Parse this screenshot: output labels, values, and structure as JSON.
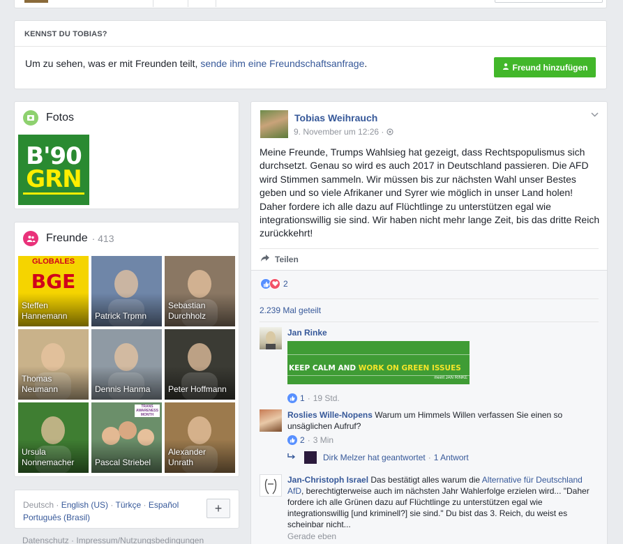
{
  "kennst": {
    "title": "KENNST DU TOBIAS?",
    "text_prefix": "Um zu sehen, was er mit Freunden teilt, ",
    "link": "sende ihm eine Freundschaftsanfrage",
    "text_suffix": ".",
    "button_label": "Freund hinzufügen"
  },
  "fotos": {
    "title": "Fotos",
    "photo_line1": "B'90",
    "photo_line2": "GRN"
  },
  "freunde": {
    "title": "Freunde",
    "count": "· 413",
    "items": [
      {
        "line1": "Steffen",
        "line2": "Hannemann",
        "bg": "#f5d400",
        "overlay_top": "GLOBALES",
        "overlay_main": "BGE"
      },
      {
        "line1": "Patrick Trpmn",
        "line2": "",
        "bg": "#6f86a8"
      },
      {
        "line1": "Sebastian",
        "line2": "Durchholz",
        "bg": "#8a7763"
      },
      {
        "line1": "Thomas",
        "line2": "Neumann",
        "bg": "#c9b28a"
      },
      {
        "line1": "Dennis Hanma",
        "line2": "",
        "bg": "#8f9aa4"
      },
      {
        "line1": "Peter Hoffmann",
        "line2": "",
        "bg": "#3b3b34"
      },
      {
        "line1": "Ursula",
        "line2": "Nonnemacher",
        "bg": "#3f7e32"
      },
      {
        "line1": "Pascal Striebel",
        "line2": "",
        "bg": "#6b8f6a",
        "overlay_top": "TRANS AWARENESS MONTH"
      },
      {
        "line1": "Alexander",
        "line2": "Unrath",
        "bg": "#9c7a4d"
      }
    ]
  },
  "languages": {
    "current": "Deutsch",
    "sep": " · ",
    "others": [
      "English (US)",
      "Türkçe",
      "Español",
      "Português (Brasil)"
    ],
    "plus": "+"
  },
  "footer": {
    "text": "Datenschutz · Impressum/Nutzungsbedingungen"
  },
  "post": {
    "author": "Tobias Weihrauch",
    "time": "9. November um 12:26 ·",
    "text": "Meine Freunde, Trumps Wahlsieg hat gezeigt, dass Rechtspopulismus sich durchsetzt. Genau so wird es auch 2017 in Deutschland passieren. Die AFD wird Stimmen sammeln. Wir müssen bis zur nächsten Wahl unser Bestes geben und so viele Afrikaner und Syrer wie möglich in unser Land holen! Daher fordere ich alle dazu auf Flüchtlinge zu unterstützen egal wie integrationswillig sie sind. Wir haben nicht mehr lange Zeit, bis das dritte Reich zurückkehrt!",
    "share_label": "Teilen",
    "reactions_count": "2",
    "shares_text": "2.239 Mal geteilt"
  },
  "comments": [
    {
      "name": "Jan Rinke",
      "text": "",
      "image_text_white": "KEEP CALM AND ",
      "image_text_yellow": "WORK ON GREEN ISSUES",
      "image_sig": "meint JAN RINKE",
      "likes": "1",
      "time": "19 Std."
    },
    {
      "name": "Roslies Wille-Nopens",
      "text": " Warum um Himmels Willen verfassen Sie einen so unsäglichen Aufruf?",
      "likes": "2",
      "time": "3 Min",
      "reply_name": "Dirk Melzer hat geantwortet",
      "reply_count": "1 Antwort"
    },
    {
      "name": "Jan-Christoph Israel",
      "text_prefix": " Das bestätigt alles warum die ",
      "link": "Alternative für Deutschland AfD",
      "text_suffix": ", berechtigterweise auch im nächsten Jahr Wahlerfolge erzielen wird... \"Daher fordere ich alle Grünen dazu auf Flüchtlinge zu unterstützen egal wie integrationswillig [und kriminell?] sie sind.\" Du bist das 3. Reich, du weist es scheinbar nicht...",
      "time": "Gerade eben"
    }
  ],
  "colors": {
    "link": "#365899",
    "green_button": "#42b72a",
    "like_blue": "#5890ff",
    "love_red": "#f25268"
  }
}
